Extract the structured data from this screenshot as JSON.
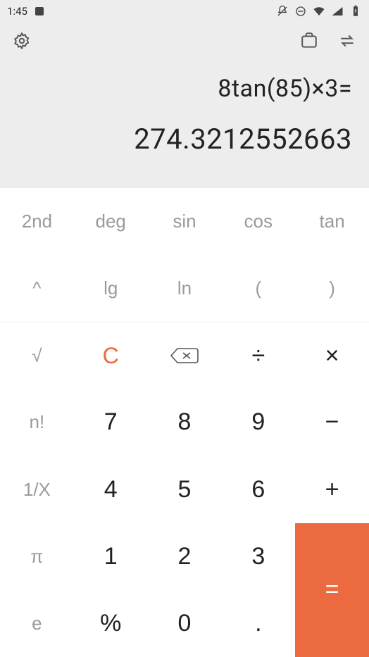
{
  "status": {
    "time": "1:45"
  },
  "display": {
    "expression": "8tan(85)×3=",
    "result": "274.3212552663"
  },
  "keys": {
    "second": "2nd",
    "deg": "deg",
    "sin": "sin",
    "cos": "cos",
    "tan": "tan",
    "pow": "^",
    "lg": "lg",
    "ln": "ln",
    "lparen": "(",
    "rparen": ")",
    "sqrt": "√",
    "clear": "C",
    "div": "÷",
    "mul": "×",
    "fact": "n!",
    "n7": "7",
    "n8": "8",
    "n9": "9",
    "sub": "−",
    "inv": "1/X",
    "n4": "4",
    "n5": "5",
    "n6": "6",
    "add": "+",
    "pi": "π",
    "n1": "1",
    "n2": "2",
    "n3": "3",
    "eq": "=",
    "e": "e",
    "pct": "%",
    "n0": "0",
    "dot": "."
  }
}
